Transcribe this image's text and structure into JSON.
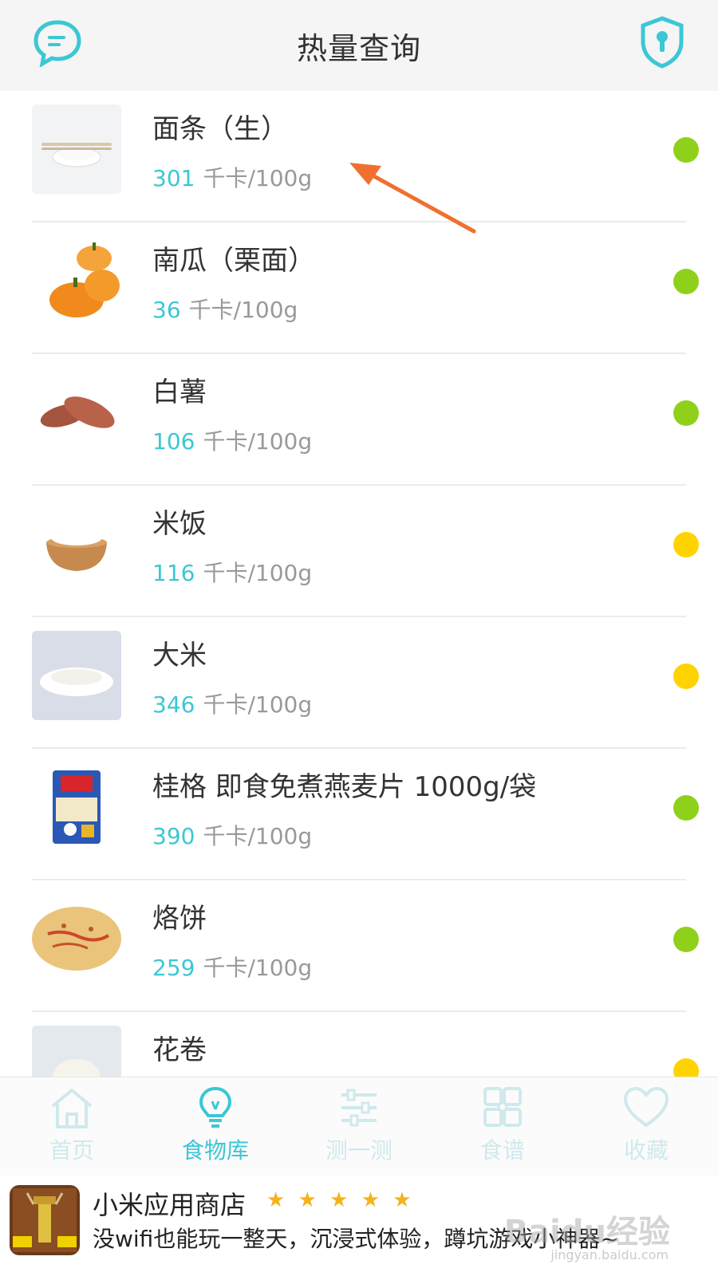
{
  "header": {
    "title": "热量查询",
    "left_icon": "chat-bubble-icon",
    "right_icon": "shield-lock-icon"
  },
  "colors": {
    "accent": "#3cc7d4",
    "green": "#8fd11a",
    "yellow": "#ffd300",
    "annotation_arrow": "#f07030"
  },
  "foods": [
    {
      "name": "面条（生）",
      "value": "301",
      "unit": "千卡/100g",
      "status": "green"
    },
    {
      "name": "南瓜（栗面）",
      "value": "36",
      "unit": "千卡/100g",
      "status": "green"
    },
    {
      "name": "白薯",
      "value": "106",
      "unit": "千卡/100g",
      "status": "green"
    },
    {
      "name": "米饭",
      "value": "116",
      "unit": "千卡/100g",
      "status": "yellow"
    },
    {
      "name": "大米",
      "value": "346",
      "unit": "千卡/100g",
      "status": "yellow"
    },
    {
      "name": "桂格 即食免煮燕麦片 1000g/袋",
      "value": "390",
      "unit": "千卡/100g",
      "status": "green"
    },
    {
      "name": "烙饼",
      "value": "259",
      "unit": "千卡/100g",
      "status": "green"
    },
    {
      "name": "花卷",
      "value": "",
      "unit": "",
      "status": "yellow"
    }
  ],
  "tabs": [
    {
      "label": "首页",
      "icon": "home-icon",
      "active": false
    },
    {
      "label": "食物库",
      "icon": "lightbulb-icon",
      "active": true
    },
    {
      "label": "测一测",
      "icon": "sliders-icon",
      "active": false
    },
    {
      "label": "食谱",
      "icon": "grid-icon",
      "active": false
    },
    {
      "label": "收藏",
      "icon": "heart-icon",
      "active": false
    }
  ],
  "ad": {
    "app_name": "小米应用商店",
    "stars": "★ ★ ★ ★ ★",
    "description": "没wifi也能玩一整天，沉浸式体验，蹲坑游戏小神器~",
    "watermark": "Baidu经验",
    "watermark_sub": "jingyan.baidu.com"
  }
}
